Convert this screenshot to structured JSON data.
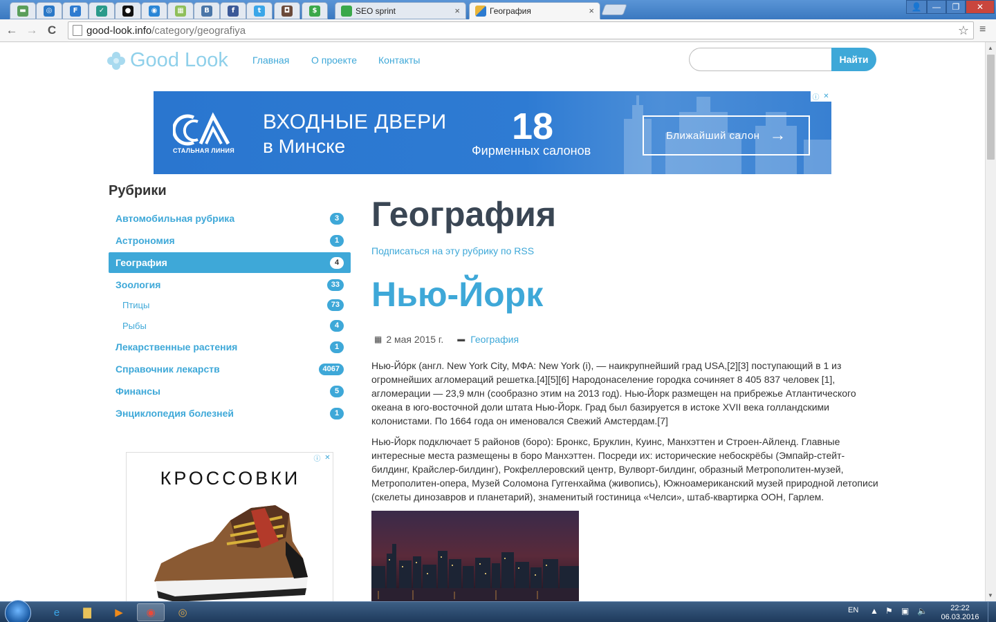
{
  "browser": {
    "tabs": [
      {
        "title": "SEO sprint",
        "close": "×",
        "favicon_color": "#3aa84a",
        "active": false
      },
      {
        "title": "География",
        "close": "×",
        "favicon_color": "#2d7bd0",
        "active": true
      }
    ],
    "pinned_tabs": [
      {
        "icon": "image-icon",
        "glyph": "▬",
        "color": "#5a9e5a"
      },
      {
        "icon": "earth-icon",
        "glyph": "◎",
        "color": "#2a78c7"
      },
      {
        "icon": "f-icon",
        "glyph": "F",
        "color": "#2e7bd0"
      },
      {
        "icon": "check-icon",
        "glyph": "✓",
        "color": "#2a9a8a"
      },
      {
        "icon": "dot-icon",
        "glyph": "●",
        "color": "#111111"
      },
      {
        "icon": "target-icon",
        "glyph": "◉",
        "color": "#2a86d6"
      },
      {
        "icon": "grid-icon",
        "glyph": "▦",
        "color": "#8fbf5a"
      },
      {
        "icon": "vk-icon",
        "glyph": "B",
        "color": "#4a76a8"
      },
      {
        "icon": "facebook-icon",
        "glyph": "f",
        "color": "#3b5998"
      },
      {
        "icon": "twitter-icon",
        "glyph": "t",
        "color": "#3aa6e8"
      },
      {
        "icon": "instagram-icon",
        "glyph": "◘",
        "color": "#6b4a3a"
      },
      {
        "icon": "dollar-icon",
        "glyph": "$",
        "color": "#3aa84a"
      }
    ],
    "url_host": "good-look.info",
    "url_path": "/category/geografiya",
    "back": "←",
    "forward": "→",
    "reload": "C",
    "star": "☆",
    "menu": "≡",
    "win_user": "👤",
    "win_min": "—",
    "win_max": "❐",
    "win_close": "✕"
  },
  "site": {
    "logo_text": "Good Look",
    "nav": [
      "Главная",
      "О проекте",
      "Контакты"
    ],
    "search_placeholder": "",
    "search_button": "Найти"
  },
  "banner": {
    "logo_caption": "СТАЛЬНАЯ ЛИНИЯ",
    "headline_1": "ВХОДНЫЕ ДВЕРИ",
    "headline_2": "в Минске",
    "number": "18",
    "number_caption": "Фирменных салонов",
    "cta": "Ближайший салон",
    "cta_arrow": "→",
    "adchoices": "ⓘ",
    "close": "✕"
  },
  "sidebar": {
    "title": "Рубрики",
    "categories": [
      {
        "label": "Автомобильная рубрика",
        "count": "3",
        "level": 0,
        "active": false
      },
      {
        "label": "Астрономия",
        "count": "1",
        "level": 0,
        "active": false
      },
      {
        "label": "География",
        "count": "4",
        "level": 0,
        "active": true
      },
      {
        "label": "Зоология",
        "count": "33",
        "level": 0,
        "active": false
      },
      {
        "label": "Птицы",
        "count": "73",
        "level": 1,
        "active": false
      },
      {
        "label": "Рыбы",
        "count": "4",
        "level": 1,
        "active": false
      },
      {
        "label": "Лекарственные растения",
        "count": "1",
        "level": 0,
        "active": false
      },
      {
        "label": "Справочник лекарств",
        "count": "4067",
        "level": 0,
        "active": false
      },
      {
        "label": "Финансы",
        "count": "5",
        "level": 0,
        "active": false
      },
      {
        "label": "Энциклопедия болезней",
        "count": "1",
        "level": 0,
        "active": false
      }
    ],
    "ad_title": "КРОССОВКИ",
    "ad_info": "ⓘ",
    "ad_close": "✕"
  },
  "main": {
    "page_title": "География",
    "rss_link": "Подписаться на эту рубрику по RSS",
    "post": {
      "title": "Нью-Йорк",
      "date": "2 мая 2015 г.",
      "category": "География",
      "paragraph_1": "Нью-Йо́рк (англ. New York City, МФА: New York (i), — наикрупнейший град USA,[2][3] поступающий в 1 из огромнейших агломераций решетка.[4][5][6] Народонаселение городка сочиняет 8 405 837 человек [1], агломерации — 23,9 млн (сообразно этим на 2013 год). Нью-Йорк размещен на прибрежье Атлантического океана в юго-восточной доли штата Нью-Йорк. Град был базируется в истоке XVII века голландскими колонистами. По 1664 года он именовался Свежий Амстердам.[7]",
      "paragraph_2": "Нью-Йорк подключает 5 районов (боро): Бронкс, Бруклин, Куинс, Манхэттен и Строен-Айленд. Главные интересные места размещены в боро Манхэттен. Посреди их: исторические небоскрёбы (Эмпайр-стейт-билдинг, Крайслер-билдинг), Рокфеллеровский центр, Вулворт-билдинг, образный Метрополитен-музей, Метрополитен-опера, Музей Соломона Гуггенхайма (живопись), Южноамериканский музей природной летописи (скелеты динозавров и планетарий), знаменитый гостиница «Челси», штаб-квартирка ООН, Гарлем."
    }
  },
  "taskbar": {
    "items": [
      {
        "icon": "ie-icon",
        "glyph": "e",
        "color": "#3aa6e8"
      },
      {
        "icon": "folder-icon",
        "glyph": "▇",
        "color": "#e8c25a"
      },
      {
        "icon": "media-player-icon",
        "glyph": "▶",
        "color": "#f08a1a"
      },
      {
        "icon": "chrome-icon",
        "glyph": "◉",
        "color": "#e84a3a"
      },
      {
        "icon": "app-icon",
        "glyph": "◎",
        "color": "#d9a64a"
      }
    ],
    "lang": "EN",
    "time": "22:22",
    "date": "06.03.2016"
  },
  "colors": {
    "accent": "#3ea8d8",
    "heading": "#3a4654",
    "banner_blue": "#2c79d2"
  }
}
